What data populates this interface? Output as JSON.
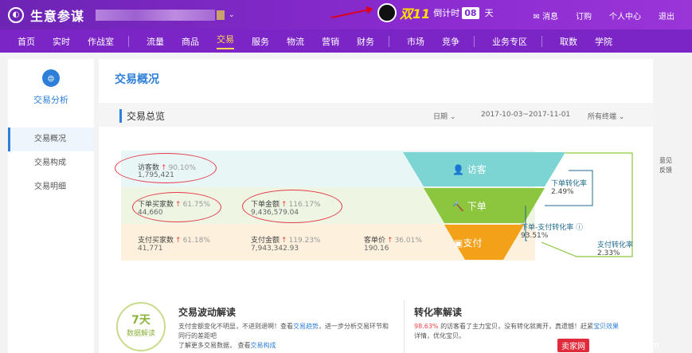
{
  "app": {
    "title": "生意参谋",
    "promo_label": "双11",
    "countdown_label": "倒计时",
    "countdown_days": "08",
    "countdown_unit": "天"
  },
  "top_right": [
    "消息",
    "订购",
    "个人中心",
    "退出"
  ],
  "nav": [
    "首页",
    "实时",
    "作战室",
    "流量",
    "商品",
    "交易",
    "服务",
    "物流",
    "营销",
    "财务",
    "市场",
    "竞争",
    "业务专区",
    "取数",
    "学院"
  ],
  "sidebar": {
    "title": "交易分析",
    "items": [
      "交易概况",
      "交易构成",
      "交易明细"
    ]
  },
  "main": {
    "title": "交易概况",
    "section": "交易总览",
    "date_label": "日期",
    "date_range": "2017-10-03~2017-11-01",
    "terminal_label": "所有终端"
  },
  "metrics": {
    "visitors": {
      "label": "访客数",
      "pct": "90.10%",
      "value": "1,795,421"
    },
    "buyers": {
      "label": "下单买家数",
      "pct": "61.75%",
      "value": "44,660"
    },
    "order_amount": {
      "label": "下单金额",
      "pct": "116.17%",
      "value": "9,436,579.04"
    },
    "pay_buyers": {
      "label": "支付买家数",
      "pct": "61.18%",
      "value": "41,771"
    },
    "pay_amount": {
      "label": "支付金额",
      "pct": "119.23%",
      "value": "7,943,342.93"
    },
    "avg_price": {
      "label": "客单价",
      "pct": "36.01%",
      "value": "190.16"
    }
  },
  "funnel": {
    "visit": "访客",
    "order": "下单",
    "pay": "支付"
  },
  "conversion": {
    "order_rate": {
      "label": "下单转化率",
      "value": "2.49%"
    },
    "order_pay_rate": {
      "label": "下单-支付转化率",
      "value": "93.51%"
    },
    "pay_rate": {
      "label": "支付转化率",
      "value": "2.33%"
    }
  },
  "analysis": {
    "stamp_top": "7天",
    "stamp_bottom": "数据解读",
    "title1": "交易波动解读",
    "line1a": "支付金额变化不明显，不进则退啊！查看",
    "line1_link": "交易趋势",
    "line1b": "，进一步分析交易环节和",
    "line2": "同行的差距吧",
    "line3a": "了解更多交易数据，  查看",
    "line3_link": "交易构成",
    "title2": "转化率解读",
    "line4pct": "98.63%",
    "line4": "的访客看了主力宝贝，没有转化就离开，真遗憾！赶紧",
    "line4_link": "宝贝效果",
    "line5": "详情，优化宝贝。"
  },
  "feedback": [
    "意见",
    "反馈"
  ],
  "watermark": {
    "brand": "卖家网",
    "site": "www.maijia.com"
  },
  "colors": {
    "brand": "#7b25c6",
    "accent": "#2d7fd9",
    "funnel_top": "#7dd5d3",
    "funnel_mid": "#8cc63e",
    "funnel_bot": "#f4a11a"
  }
}
